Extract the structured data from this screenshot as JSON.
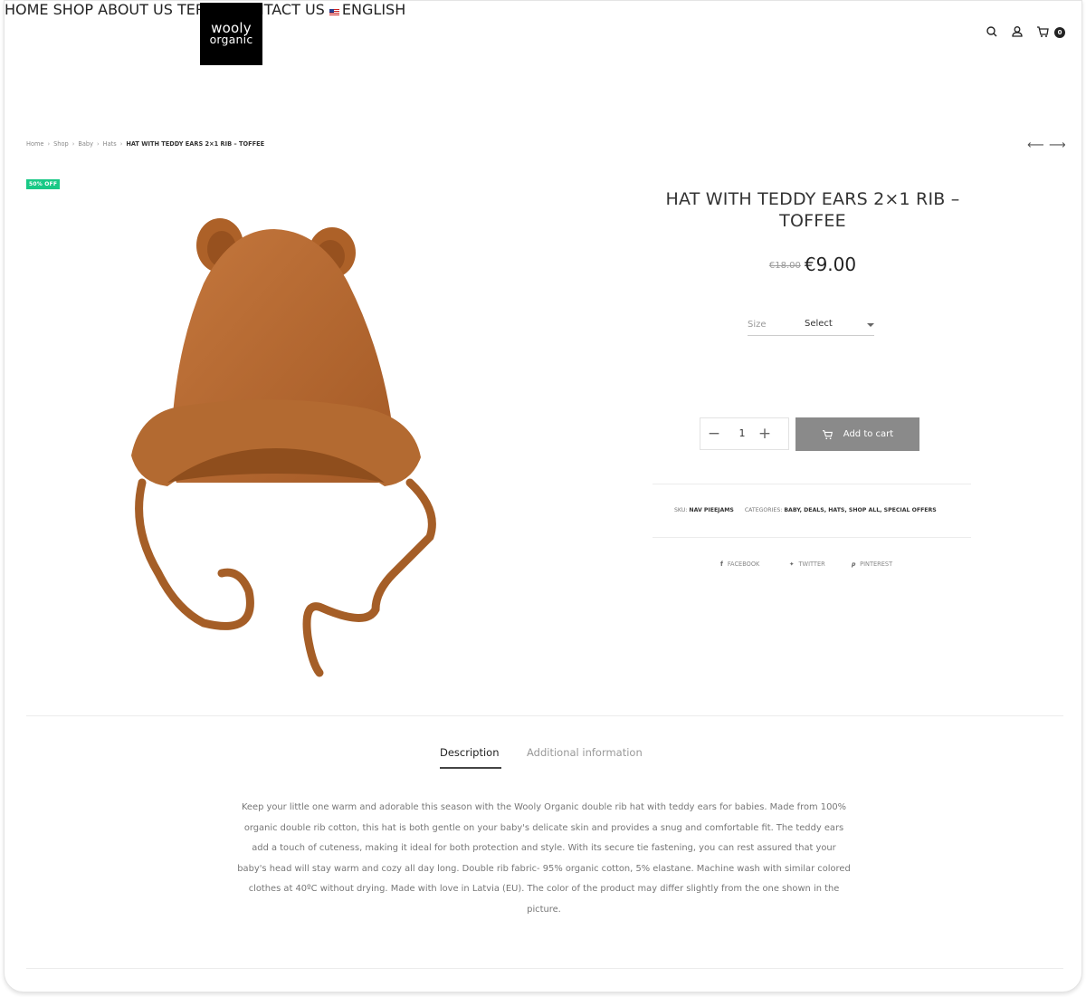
{
  "logo": {
    "line1": "wooly",
    "line2": "organic"
  },
  "nav": {
    "items": [
      "HOME",
      "SHOP",
      "ABOUT US",
      "TERMS",
      "CONTACT US"
    ],
    "language": "ENGLISH"
  },
  "header_icons": [
    "search-icon",
    "user-icon",
    "cart-icon"
  ],
  "cart_count": "0",
  "breadcrumb": {
    "items": [
      "Home",
      "Shop",
      "Baby",
      "Hats"
    ],
    "current": "HAT WITH TEDDY EARS 2×1 RIB – TOFFEE"
  },
  "sale_badge": "50% OFF",
  "product": {
    "title": "HAT WITH TEDDY EARS 2×1 RIB – TOFFEE",
    "old_price": "€18.00",
    "price": "€9.00",
    "size_label": "Size",
    "size_value": "Select",
    "quantity": "1",
    "add_to_cart": "Add to cart",
    "sku_label": "SKU:",
    "sku": "NAV PIEEJAMS",
    "categories_label": "CATEGORIES:",
    "categories": "BABY, DEALS, HATS, SHOP ALL, SPECIAL OFFERS",
    "color": "#b86a33"
  },
  "share": {
    "facebook": "FACEBOOK",
    "twitter": "TWITTER",
    "pinterest": "PINTEREST"
  },
  "tabs": {
    "description": "Description",
    "additional": "Additional information"
  },
  "description_lines": [
    "Keep your little one warm and adorable this season with the Wooly Organic double rib hat with teddy ears for babies. Made from 100%",
    "organic double rib cotton, this hat is both gentle on your baby's delicate skin and provides a snug and comfortable fit. The teddy ears",
    "add a touch of cuteness, making it ideal for both protection and style. With its secure tie fastening, you can rest assured that your",
    "baby's head will stay warm and cozy all day long. Double rib fabric- 95% organic cotton, 5% elastane. Machine wash with similar colored",
    "clothes at 40ºC without drying. Made with love in Latvia (EU). The color of the product may differ slightly from the one shown in the",
    "picture."
  ],
  "colors": {
    "accent_badge": "#19c986",
    "button": "#8a8a8a"
  }
}
